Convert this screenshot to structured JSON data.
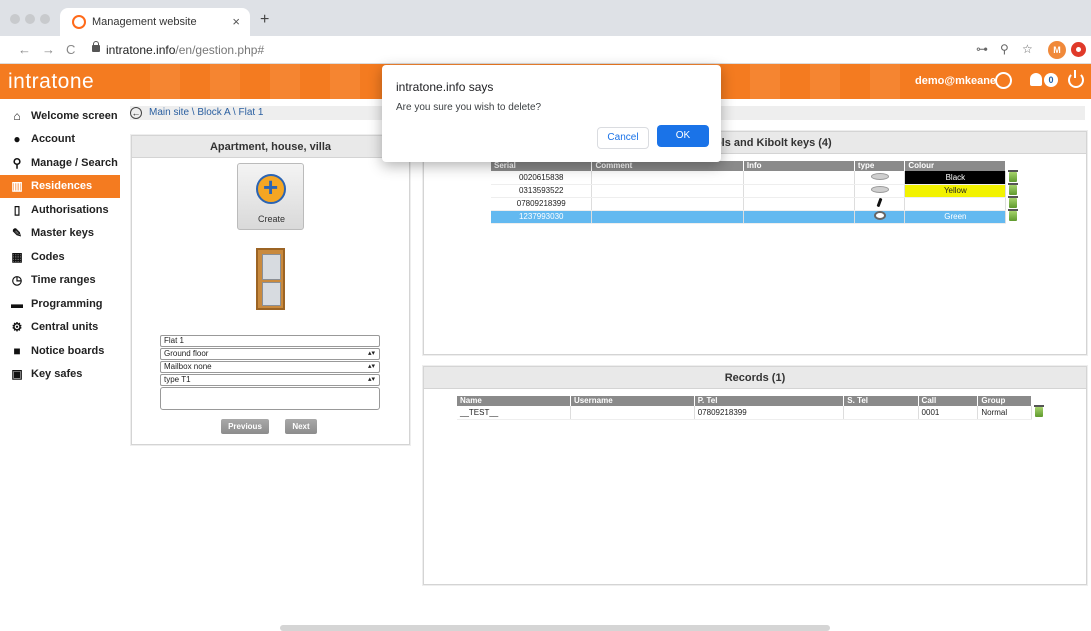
{
  "browser": {
    "tab_title": "Management website",
    "tab_close": "×",
    "new_tab": "+",
    "back": "←",
    "forward": "→",
    "reload": "C",
    "url_domain": "intratone.info",
    "url_path": "/en/gestion.php#",
    "key_icon": "⊶",
    "zoom_icon": "⚲",
    "star_icon": "☆",
    "profile_initial": "M"
  },
  "header": {
    "logo": "intratone",
    "user": "demo@mkeane",
    "notification_count": "0",
    "brand_color": "#f47b20"
  },
  "sidebar": {
    "items": [
      {
        "label": "Welcome screen",
        "icon": "home-icon",
        "glyph": "⌂"
      },
      {
        "label": "Account",
        "icon": "user-icon",
        "glyph": "●"
      },
      {
        "label": "Manage / Search",
        "icon": "search-icon",
        "glyph": "⚲"
      },
      {
        "label": "Residences",
        "icon": "building-icon",
        "glyph": "▥"
      },
      {
        "label": "Authorisations",
        "icon": "document-icon",
        "glyph": "▯"
      },
      {
        "label": "Master keys",
        "icon": "key-icon",
        "glyph": "✎"
      },
      {
        "label": "Codes",
        "icon": "keypad-icon",
        "glyph": "▦"
      },
      {
        "label": "Time ranges",
        "icon": "calendar-clock-icon",
        "glyph": "◷"
      },
      {
        "label": "Programming",
        "icon": "programmer-icon",
        "glyph": "▬"
      },
      {
        "label": "Central units",
        "icon": "gear-icon",
        "glyph": "⚙"
      },
      {
        "label": "Notice boards",
        "icon": "notice-board-icon",
        "glyph": "■"
      },
      {
        "label": "Key safes",
        "icon": "safe-icon",
        "glyph": "▣"
      }
    ],
    "active_index": 3
  },
  "breadcrumb": {
    "back_glyph": "←",
    "text": "Main site \\ Block A \\ Flat 1"
  },
  "apartment_panel": {
    "title": "Apartment, house, villa",
    "create_label": "Create",
    "name_value": "Flat 1",
    "floor_value": "Ground floor",
    "mailbox_value": "Mailbox none",
    "type_value": "type T1",
    "previous_label": "Previous",
    "next_label": "Next"
  },
  "keys_panel": {
    "title": "e controls and Kibolt keys (4)",
    "columns": [
      "Serial",
      "Comment",
      "Info",
      "type",
      "Colour"
    ],
    "rows": [
      {
        "serial": "0020615838",
        "comment": "",
        "info": "",
        "type": "remote",
        "colour": "Black",
        "colour_hex": "#000000",
        "text_color": "#ffffff"
      },
      {
        "serial": "0313593522",
        "comment": "",
        "info": "",
        "type": "remote",
        "colour": "Yellow",
        "colour_hex": "#f2f200",
        "text_color": "#222222"
      },
      {
        "serial": "07809218399",
        "comment": "",
        "info": "",
        "type": "",
        "colour": "",
        "colour_hex": "#ffffff",
        "text_color": "#222222"
      },
      {
        "serial": "1237993030",
        "comment": "",
        "info": "",
        "type": "dial",
        "colour": "Green",
        "colour_hex": "#63b9f0",
        "text_color": "#ffffff"
      }
    ]
  },
  "records_panel": {
    "title": "Records (1)",
    "columns": [
      "Name",
      "Username",
      "P. Tel",
      "S. Tel",
      "Call",
      "Group"
    ],
    "rows": [
      {
        "name": "__TEST__",
        "username": "",
        "ptel": "07809218399",
        "stel": "",
        "call": "0001",
        "group": "Normal"
      }
    ]
  },
  "dialog": {
    "title": "intratone.info says",
    "message": "Are you sure you wish to delete?",
    "cancel_label": "Cancel",
    "ok_label": "OK"
  }
}
